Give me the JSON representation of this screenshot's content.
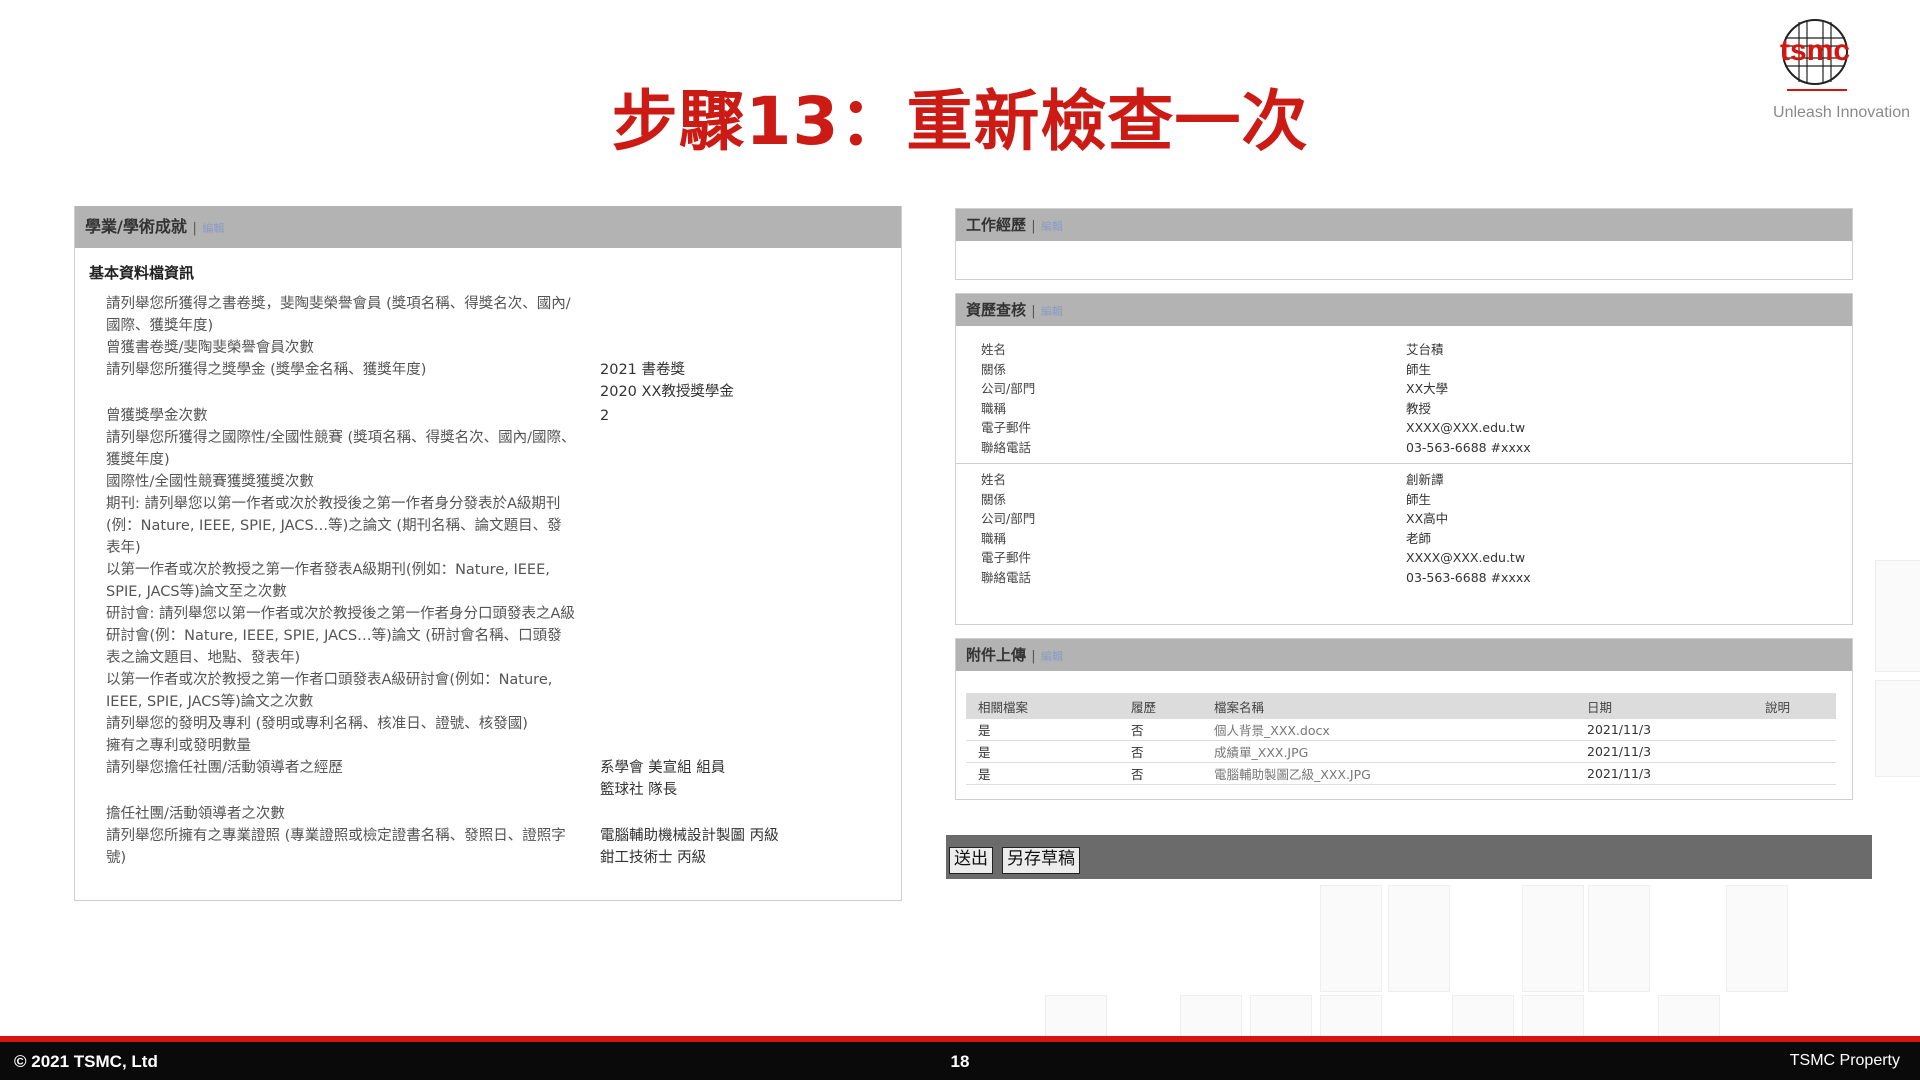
{
  "slide": {
    "title": "步驟13：重新檢查一次",
    "tagline": "Unleash Innovation",
    "logo_text": "tsmc"
  },
  "left_panel": {
    "header": "學業/學術成就",
    "sep": "|",
    "edit": "編輯",
    "subtitle": "基本資料檔資訊",
    "rows": [
      {
        "q": "請列舉您所獲得之書卷獎，斐陶斐榮譽會員 (獎項名稱、得獎名次、國內/國際、獲獎年度)",
        "a": ""
      },
      {
        "q": "曾獲書卷獎/斐陶斐榮譽會員次數",
        "a": ""
      },
      {
        "q": "請列舉您所獲得之獎學金 (獎學金名稱、獲獎年度)",
        "a": "2021 書卷獎\n2020 XX教授獎學金"
      },
      {
        "q": "曾獲獎學金次數",
        "a": "2"
      },
      {
        "q": "請列舉您所獲得之國際性/全國性競賽 (獎項名稱、得獎名次、國內/國際、獲獎年度)",
        "a": ""
      },
      {
        "q": "國際性/全國性競賽獲獎獲獎次數",
        "a": ""
      },
      {
        "q": "期刊: 請列舉您以第一作者或次於教授後之第一作者身分發表於A級期刊(例：Nature, IEEE, SPIE, JACS…等)之論文 (期刊名稱、論文題目、發表年)",
        "a": ""
      },
      {
        "q": "以第一作者或次於教授之第一作者發表A級期刊(例如：Nature, IEEE, SPIE, JACS等)論文至之次數",
        "a": ""
      },
      {
        "q": "研討會: 請列舉您以第一作者或次於教授後之第一作者身分口頭發表之A級研討會(例：Nature, IEEE, SPIE, JACS…等)論文 (研討會名稱、口頭發表之論文題目、地點、發表年)",
        "a": ""
      },
      {
        "q": "以第一作者或次於教授之第一作者口頭發表A級研討會(例如：Nature, IEEE, SPIE, JACS等)論文之次數",
        "a": ""
      },
      {
        "q": "請列舉您的發明及專利 (發明或專利名稱、核准日、證號、核發國)",
        "a": ""
      },
      {
        "q": "擁有之專利或發明數量",
        "a": ""
      },
      {
        "q": "請列舉您擔任社團/活動領導者之經歷",
        "a": "系學會 美宣組 組員\n籃球社 隊長"
      },
      {
        "q": "擔任社團/活動領導者之次數",
        "a": ""
      },
      {
        "q": "請列舉您所擁有之專業證照 (專業證照或檢定證書名稱、發照日、證照字號)",
        "a": "電腦輔助機械設計製圖 丙級\n鉗工技術士 丙級"
      }
    ]
  },
  "work_panel": {
    "header": "工作經歷",
    "sep": "|",
    "edit": "編輯"
  },
  "ref_panel": {
    "header": "資歷查核",
    "sep": "|",
    "edit": "編輯",
    "people": [
      {
        "rows": [
          {
            "k": "姓名",
            "v": "艾台積"
          },
          {
            "k": "關係",
            "v": "師生"
          },
          {
            "k": "公司/部門",
            "v": "XX大學"
          },
          {
            "k": "職稱",
            "v": "教授"
          },
          {
            "k": "電子郵件",
            "v": "XXXX@XXX.edu.tw"
          },
          {
            "k": "聯絡電話",
            "v": "03-563-6688 #xxxx"
          }
        ]
      },
      {
        "rows": [
          {
            "k": "姓名",
            "v": "創新譚"
          },
          {
            "k": "關係",
            "v": "師生"
          },
          {
            "k": "公司/部門",
            "v": "XX高中"
          },
          {
            "k": "職稱",
            "v": "老師"
          },
          {
            "k": "電子郵件",
            "v": "XXXX@XXX.edu.tw"
          },
          {
            "k": "聯絡電話",
            "v": "03-563-6688 #xxxx"
          }
        ]
      }
    ]
  },
  "attach_panel": {
    "header": "附件上傳",
    "sep": "|",
    "edit": "編輯",
    "columns": [
      "相關檔案",
      "履歷",
      "檔案名稱",
      "日期",
      "說明"
    ],
    "rows": [
      {
        "related": "是",
        "resume": "否",
        "name": "個人背景_XXX.docx",
        "date": "2021/11/3",
        "note": ""
      },
      {
        "related": "是",
        "resume": "否",
        "name": "成績單_XXX.JPG",
        "date": "2021/11/3",
        "note": ""
      },
      {
        "related": "是",
        "resume": "否",
        "name": "電腦輔助製圖乙級_XXX.JPG",
        "date": "2021/11/3",
        "note": ""
      }
    ]
  },
  "actions": {
    "submit": "送出",
    "save_draft": "另存草稿"
  },
  "footer": {
    "left": "© 2021 TSMC, Ltd",
    "page": "18",
    "right": "TSMC Property"
  },
  "colors": {
    "title_red": "#cc1a14",
    "footer_red": "#d7150f",
    "header_gray": "#b3b3b3",
    "action_gray": "#6b6b6b"
  }
}
